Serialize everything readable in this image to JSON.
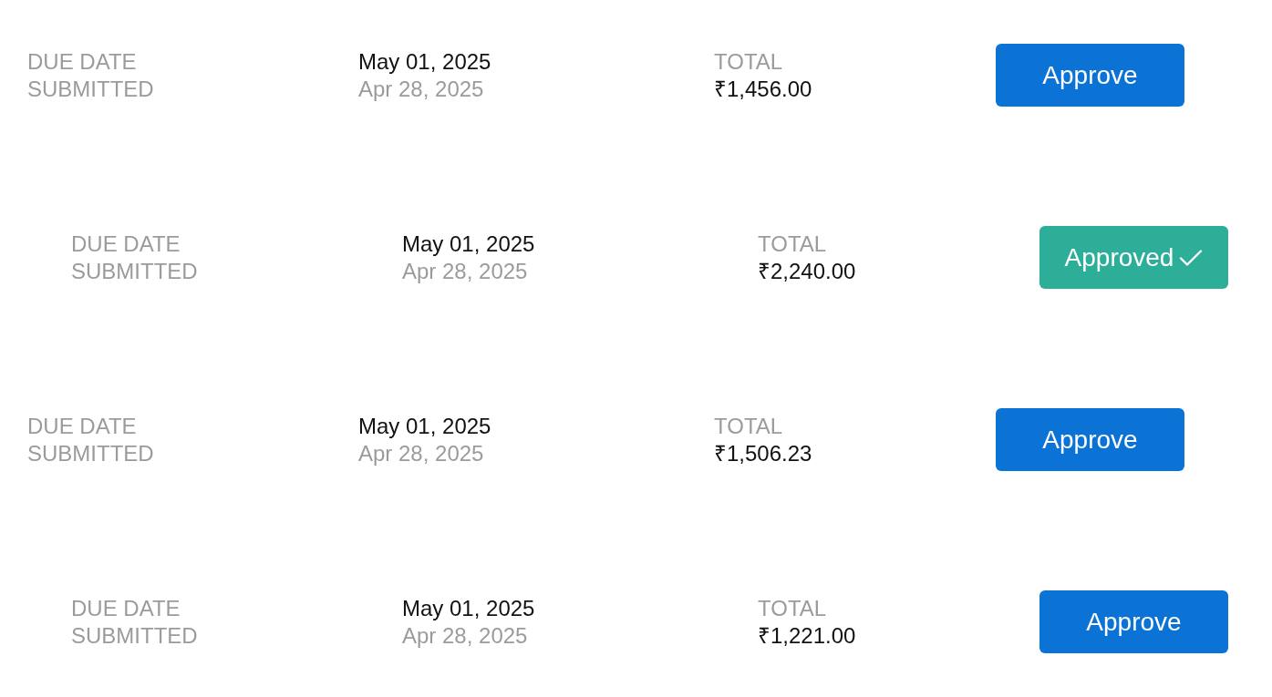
{
  "rows": [
    {
      "due_date_label": "DUE DATE",
      "submitted_label": "SUBMITTED",
      "due_date": "May 01, 2025",
      "submitted_date": "Apr 28, 2025",
      "total_label": "TOTAL",
      "total": "₹1,456.00",
      "button": {
        "label": "Approve",
        "approved": false
      }
    },
    {
      "due_date_label": "DUE DATE",
      "submitted_label": "SUBMITTED",
      "due_date": "May 01, 2025",
      "submitted_date": "Apr 28, 2025",
      "total_label": "TOTAL",
      "total": "₹2,240.00",
      "button": {
        "label": "Approved",
        "approved": true
      }
    },
    {
      "due_date_label": "DUE DATE",
      "submitted_label": "SUBMITTED",
      "due_date": "May 01, 2025",
      "submitted_date": "Apr 28, 2025",
      "total_label": "TOTAL",
      "total": "₹1,506.23",
      "button": {
        "label": "Approve",
        "approved": false
      }
    },
    {
      "due_date_label": "DUE DATE",
      "submitted_label": "SUBMITTED",
      "due_date": "May 01, 2025",
      "submitted_date": "Apr 28, 2025",
      "total_label": "TOTAL",
      "total": "₹1,221.00",
      "button": {
        "label": "Approve",
        "approved": false
      }
    }
  ]
}
